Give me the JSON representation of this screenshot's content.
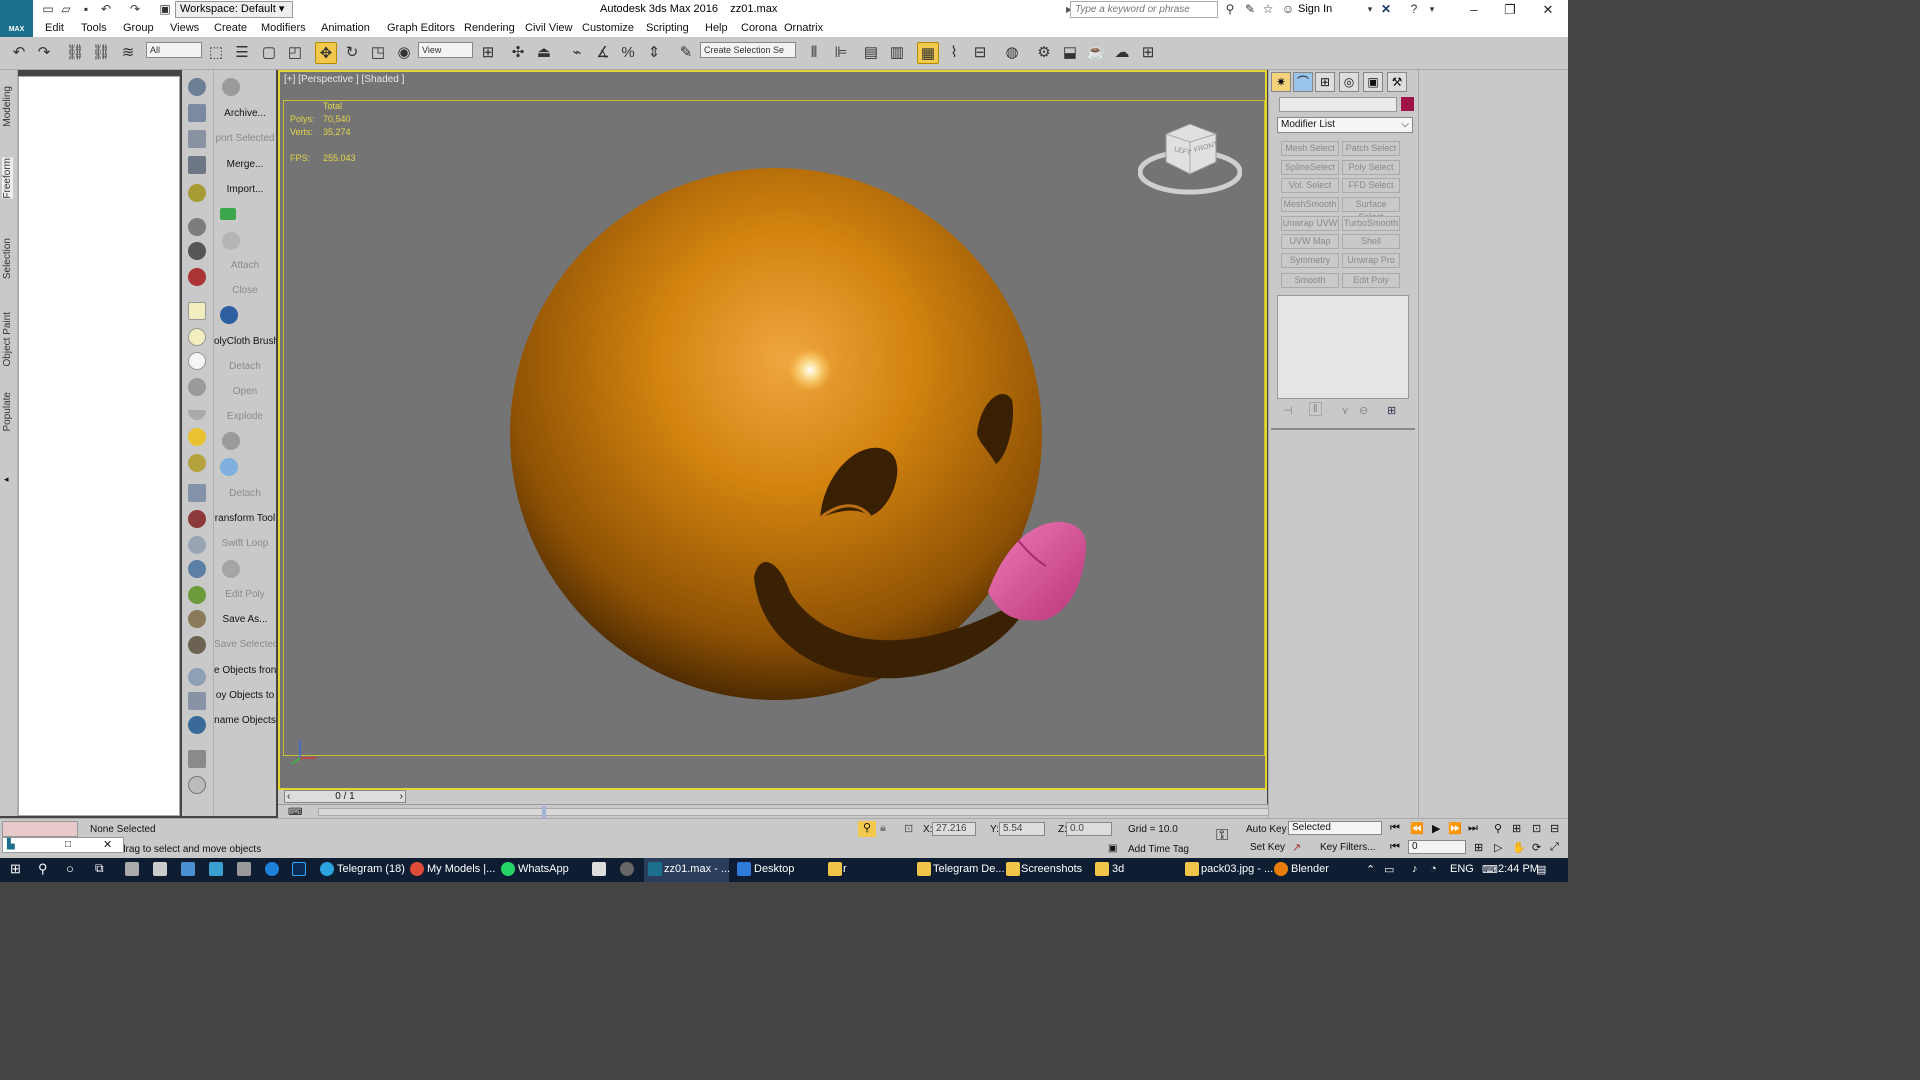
{
  "title_bar": {
    "workspace": "Workspace: Default",
    "app_title": "Autodesk 3ds Max 2016",
    "file_name": "zz01.max",
    "search_placeholder": "Type a keyword or phrase",
    "sign_in": "Sign In"
  },
  "logo": {
    "text": "MAX"
  },
  "menu": [
    "Edit",
    "Tools",
    "Group",
    "Views",
    "Create",
    "Modifiers",
    "Animation",
    "Graph Editors",
    "Rendering",
    "Civil View",
    "Customize",
    "Scripting",
    "Help",
    "Corona",
    "Ornatrix"
  ],
  "toolbar": {
    "filter_select": "All",
    "ref_coord_select": "View",
    "selection_set_placeholder": "Create Selection Se"
  },
  "ribbon_tabs": [
    "Modeling",
    "Freeform",
    "Selection",
    "Object Paint",
    "Populate"
  ],
  "left_labels": [
    {
      "text": "Archive...",
      "enabled": true
    },
    {
      "text": "port Selected",
      "enabled": false
    },
    {
      "text": "Merge...",
      "enabled": true
    },
    {
      "text": "Import...",
      "enabled": true
    },
    {
      "text": "Attach",
      "enabled": false
    },
    {
      "text": "Close",
      "enabled": false
    },
    {
      "text": "olyCloth Brush",
      "enabled": true
    },
    {
      "text": "Detach",
      "enabled": false
    },
    {
      "text": "Open",
      "enabled": false
    },
    {
      "text": "Explode",
      "enabled": false
    },
    {
      "text": "Detach",
      "enabled": false
    },
    {
      "text": "ransform Tool",
      "enabled": true
    },
    {
      "text": "Swift Loop",
      "enabled": false
    },
    {
      "text": "Edit Poly",
      "enabled": false
    },
    {
      "text": "Save As...",
      "enabled": true
    },
    {
      "text": "Save Selected",
      "enabled": false
    },
    {
      "text": "e Objects fron",
      "enabled": true
    },
    {
      "text": "oy Objects to",
      "enabled": true
    },
    {
      "text": "name Objects",
      "enabled": true
    }
  ],
  "viewport": {
    "label": "[+] [Perspective ] [Shaded ]",
    "stats_header": "Total",
    "polys_label": "Polys:",
    "polys_value": "70,540",
    "verts_label": "Verts:",
    "verts_value": "35,274",
    "fps_label": "FPS:",
    "fps_value": "255.043",
    "cube_left": "LEFT",
    "cube_front": "FRONT",
    "ball_color": "#c97a10",
    "tongue_color": "#e0579a"
  },
  "timeline": {
    "frame": "0 / 1"
  },
  "command_panel": {
    "modifier_list": "Modifier List",
    "swatch_color": "#9e1246",
    "modifiers": [
      "Mesh Select",
      "Patch Select",
      "SplineSelect",
      "Poly Select",
      "Vol. Select",
      "FFD Select",
      "MeshSmooth",
      "Surface Select",
      "Unwrap UVW",
      "TurboSmooth",
      "UVW Map",
      "Shell",
      "Symmetry",
      "Unwrap Pro",
      "Smooth",
      "Edit Poly"
    ]
  },
  "status": {
    "selection": "None Selected",
    "prompt": "drag to select and move objects",
    "x_label": "X:",
    "x_value": "27.216",
    "y_label": "Y:",
    "y_value": "5.54",
    "z_label": "Z:",
    "z_value": "0.0",
    "grid": "Grid = 10.0",
    "add_time_tag": "Add Time Tag",
    "auto_key": "Auto Key",
    "set_key": "Set Key",
    "key_mode": "Selected",
    "key_filters": "Key Filters...",
    "frame_field": "0"
  },
  "taskbar": {
    "items": [
      "Telegram (18)",
      "My Models |...",
      "WhatsApp",
      "zz01.max - ...",
      "Desktop",
      "r",
      "Telegram De...",
      "Screenshots",
      "3d",
      "pack03.jpg - ...",
      "Blender"
    ],
    "lang": "ENG",
    "time": "2:44 PM"
  }
}
